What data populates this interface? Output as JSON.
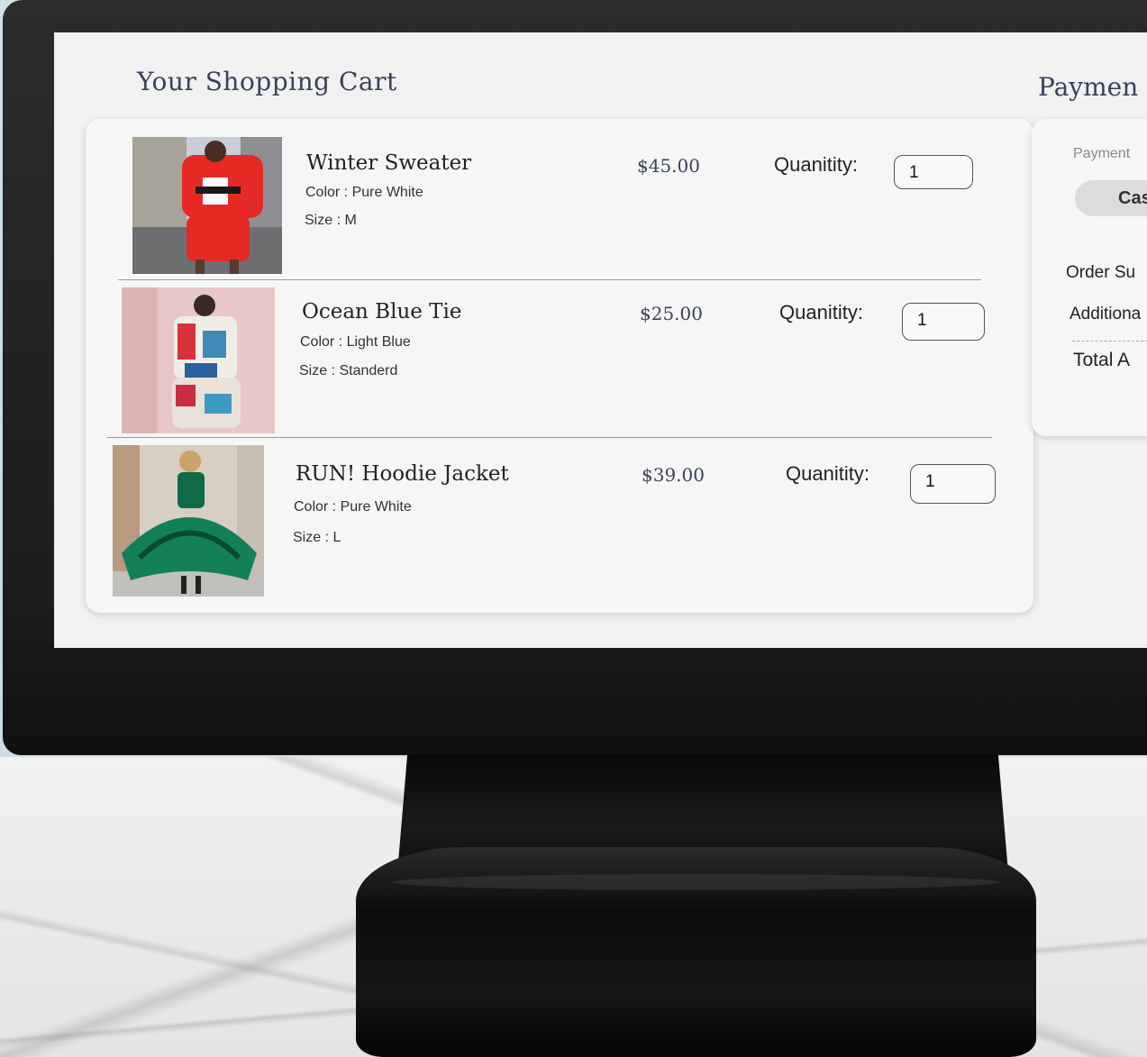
{
  "cart": {
    "title": "Your Shopping Cart",
    "items": [
      {
        "name": "Winter Sweater",
        "color": "Color : Pure White",
        "size": "Size : M",
        "price": "$45.00",
        "qty_label": "Quanitity:",
        "qty_value": "1",
        "image": "red-suit-photo"
      },
      {
        "name": "Ocean Blue Tie",
        "color": "Color : Light Blue",
        "size": "Size : Standerd",
        "price": "$25.00",
        "qty_label": "Quanitity:",
        "qty_value": "1",
        "image": "scarf-dress-photo"
      },
      {
        "name": "RUN! Hoodie Jacket",
        "color": "Color : Pure White",
        "size": "Size : L",
        "price": "$39.00",
        "qty_label": "Quanitity:",
        "qty_value": "1",
        "image": "green-dress-photo"
      }
    ]
  },
  "payment": {
    "title": "Paymen",
    "method_label": "Payment",
    "method_selected": "Cas",
    "order_summary": "Order Su",
    "additional": "Additiona",
    "total": "Total A"
  },
  "colors": {
    "heading": "#3a4258",
    "screen_bg": "#f1f1f1",
    "bezel": "#1b1c1e"
  }
}
